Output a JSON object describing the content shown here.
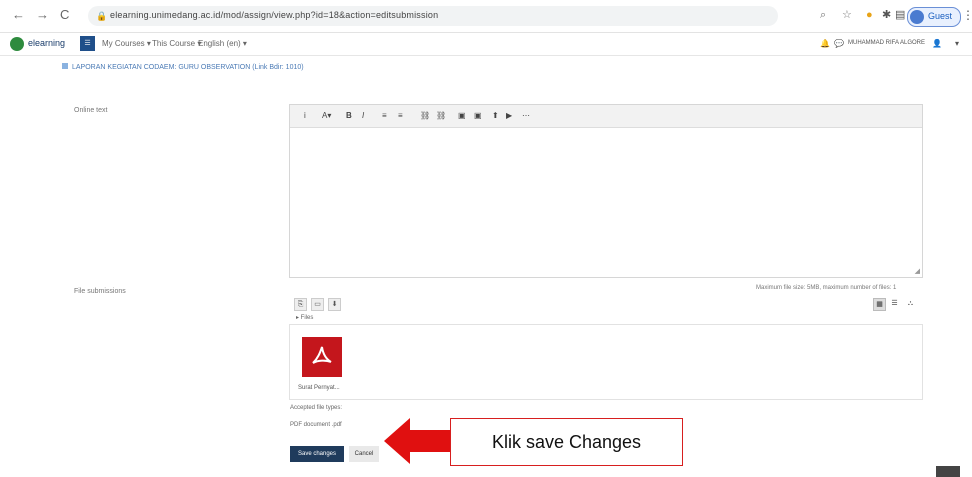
{
  "browser": {
    "url": "elearning.unimedang.ac.id/mod/assign/view.php?id=18&action=editsubmission",
    "profile_label": "Guest",
    "nav_back": "←",
    "nav_forward": "→",
    "nav_reload": "C"
  },
  "navbar": {
    "brand": "elearning",
    "grade_icon_label": "☰",
    "menus": [
      "My Courses ▾",
      "This Course ▾",
      "English (en) ▾"
    ],
    "user_name": "MUHAMMAD RIFA ALGORE",
    "notif_icon": "bell-icon",
    "chat_icon": "chat-icon"
  },
  "breadcrumb": "LAPORAN KEGIATAN CODAEM: GURU OBSERVATION (Link Bdir: 1010)",
  "form": {
    "online_text_label": "Online text",
    "file_submissions_label": "File submissions",
    "toolbar_items": [
      "i",
      "A▾",
      "B",
      "I",
      "≡",
      "≡",
      "⛓",
      "⛓",
      "▣",
      "▣",
      "⬆",
      "▶",
      "⋯"
    ],
    "max_info": "Maximum file size: 5MB, maximum number of files: 1",
    "files_path": "▸ Files",
    "file_name": "Surat Pernyat...",
    "accepted_label": "Accepted file types:",
    "accepted_value": "PDF document .pdf",
    "save_label": "Save changes",
    "cancel_label": "Cancel"
  },
  "callout": {
    "text": "Klik save Changes",
    "color": "#d71f1f"
  },
  "colors": {
    "primary": "#1f3b5c",
    "pdf_red": "#c4161c",
    "brand_green": "#2e8b3e"
  }
}
